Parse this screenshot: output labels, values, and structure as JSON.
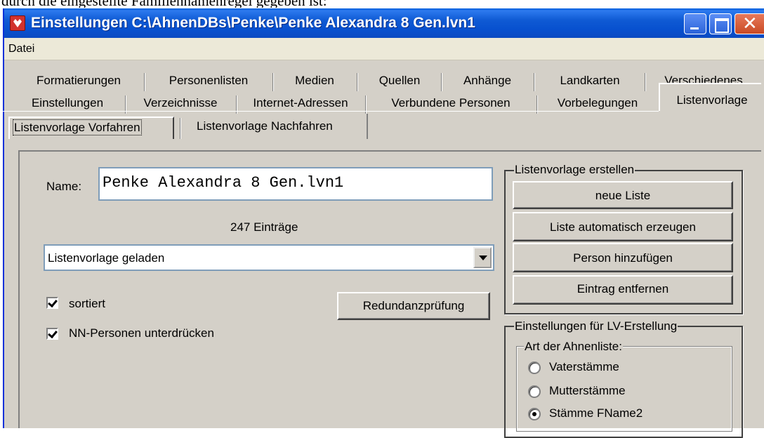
{
  "doc_text": "durch die eingestellte Familiennamenregel gegeben ist:",
  "window": {
    "title": "Einstellungen  C:\\AhnenDBs\\Penke\\Penke Alexandra 8 Gen.lvn1"
  },
  "menu": {
    "items": [
      "Datei"
    ]
  },
  "tabs_row1": [
    "Formatierungen",
    "Personenlisten",
    "Medien",
    "Quellen",
    "Anhänge",
    "Landkarten",
    "Verschiedenes"
  ],
  "tabs_row2": [
    "Einstellungen",
    "Verzeichnisse",
    "Internet-Adressen",
    "Verbundene Personen",
    "Vorbelegungen",
    "Listenvorlage"
  ],
  "selected_tab": "Listenvorlage",
  "subtabs": [
    "Listenvorlage Vorfahren",
    "Listenvorlage Nachfahren"
  ],
  "form": {
    "name_label": "Name:",
    "name_value": "Penke Alexandra 8 Gen.lvn1",
    "entries_count": "247 Einträge",
    "status_combo": "Listenvorlage geladen",
    "check_sorted": "sortiert",
    "check_sorted_checked": true,
    "check_nn": "NN-Personen unterdrücken",
    "check_nn_checked": true,
    "redundancy_button": "Redundanzprüfung"
  },
  "group_create": {
    "title": "Listenvorlage erstellen",
    "buttons": [
      "neue Liste",
      "Liste automatisch erzeugen",
      "Person hinzufügen",
      "Eintrag entfernen"
    ]
  },
  "group_settings": {
    "title": "Einstellungen für LV-Erstellung",
    "sub_title": "Art der Ahnenliste:",
    "options": [
      "Vaterstämme",
      "Mutterstämme",
      "Stämme FName2"
    ],
    "selected_option": "Stämme FName2"
  }
}
